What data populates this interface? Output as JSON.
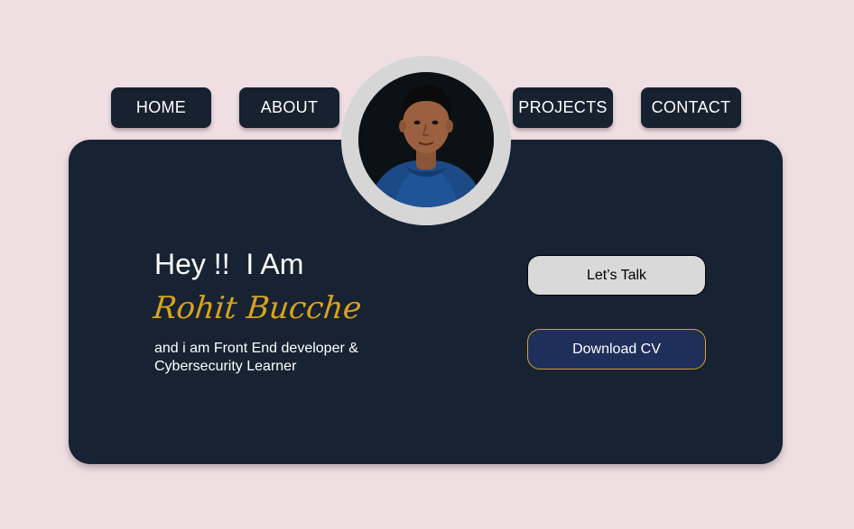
{
  "nav": {
    "home": "HOME",
    "about": "ABOUT",
    "projects": "PROJECTS",
    "contact": "CONTACT"
  },
  "hero": {
    "greeting": "Hey !!  I Am",
    "name": "Rohit Bucche",
    "description": "and i am Front End developer & Cybersecurity Learner"
  },
  "buttons": {
    "talk": "Let’s Talk",
    "download_cv": "Download CV"
  },
  "colors": {
    "background": "#efdfe3",
    "card": "#172232",
    "accent": "#d8a21e",
    "cv_button": "#1f2f5c"
  }
}
